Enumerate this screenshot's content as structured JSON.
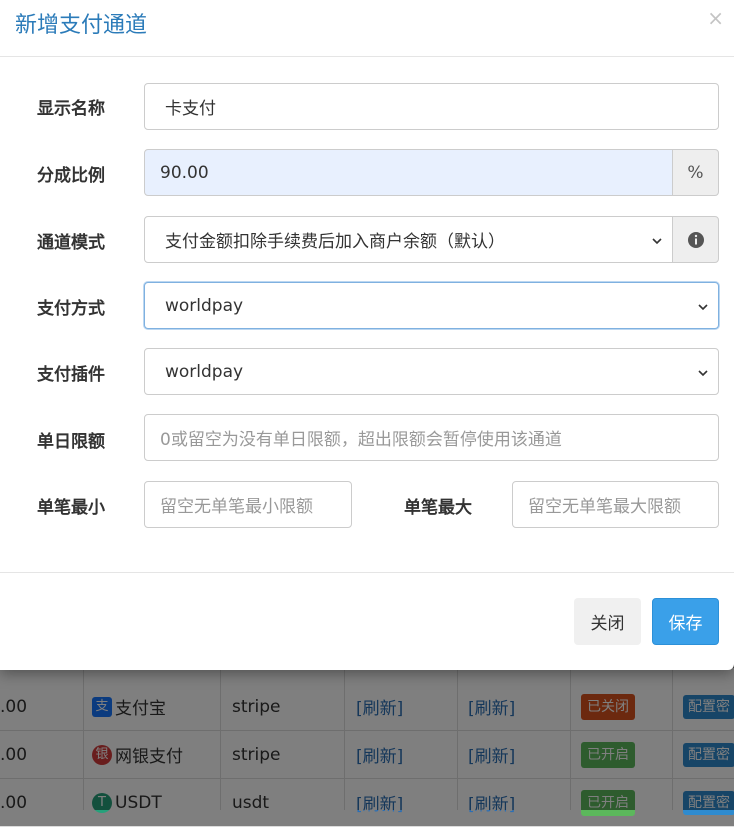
{
  "modal": {
    "title": "新增支付通道",
    "close_glyph": "×"
  },
  "form": {
    "display_name": {
      "label": "显示名称",
      "value": "卡支付"
    },
    "split_ratio": {
      "label": "分成比例",
      "value": "90.00",
      "unit": "%"
    },
    "channel_mode": {
      "label": "通道模式",
      "value": "支付金额扣除手续费后加入商户余额（默认）",
      "info_icon": "info-circle-icon"
    },
    "pay_method": {
      "label": "支付方式",
      "value": "worldpay"
    },
    "pay_plugin": {
      "label": "支付插件",
      "value": "worldpay"
    },
    "daily_limit": {
      "label": "单日限额",
      "placeholder": "0或留空为没有单日限额，超出限额会暂停使用该通道"
    },
    "min_single": {
      "label": "单笔最小",
      "placeholder": "留空无单笔最小限额"
    },
    "max_single": {
      "label": "单笔最大",
      "placeholder": "留空无单笔最大限额"
    }
  },
  "footer": {
    "close_label": "关闭",
    "save_label": "保存"
  },
  "background_table": {
    "rows": [
      {
        "rate": ".00",
        "name": "支付宝",
        "icon": "alipay-icon",
        "icon_color": "#1677ff",
        "plugin": "stripe",
        "refresh1": "[刷新]",
        "refresh2": "[刷新]",
        "status": "已关闭",
        "status_color": "#d9531e",
        "config": "配置密"
      },
      {
        "rate": ".00",
        "name": "网银支付",
        "icon": "unionpay-icon",
        "icon_color": "#d23b3b",
        "plugin": "stripe",
        "refresh1": "[刷新]",
        "refresh2": "[刷新]",
        "status": "已开启",
        "status_color": "#5cb85c",
        "config": "配置密"
      },
      {
        "rate": ".00",
        "name": "USDT",
        "icon": "tether-icon",
        "icon_color": "#26a17b",
        "plugin": "usdt",
        "refresh1": "[刷新]",
        "refresh2": "[刷新]",
        "status": "已开启",
        "status_color": "#5cb85c",
        "config": "配置密"
      }
    ]
  }
}
